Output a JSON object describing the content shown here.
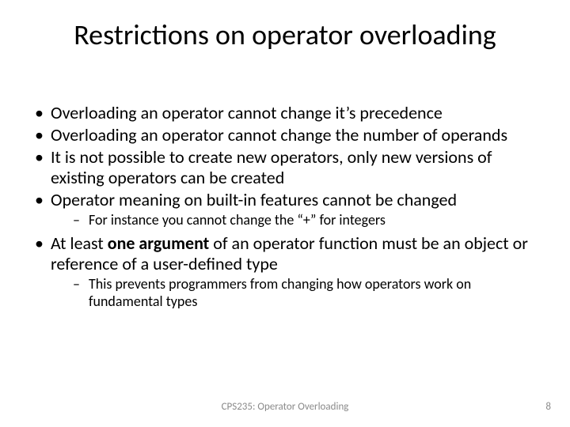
{
  "title": "Restrictions on operator overloading",
  "bullets": {
    "b1": "Overloading an operator cannot change it’s precedence",
    "b2": "Overloading an operator cannot change the number of operands",
    "b3": "It is not possible to create new operators, only new versions of existing operators can be created",
    "b4": "Operator meaning on built-in features cannot be changed",
    "b4_sub1": "For instance you cannot change the “+” for integers",
    "b5_pre": "At least ",
    "b5_bold": "one argument",
    "b5_post": " of an operator function must be an object or reference of a user-defined type",
    "b5_sub1": "This prevents programmers from changing how operators work on fundamental types"
  },
  "footer": {
    "center": "CPS235: Operator Overloading",
    "page": "8"
  }
}
